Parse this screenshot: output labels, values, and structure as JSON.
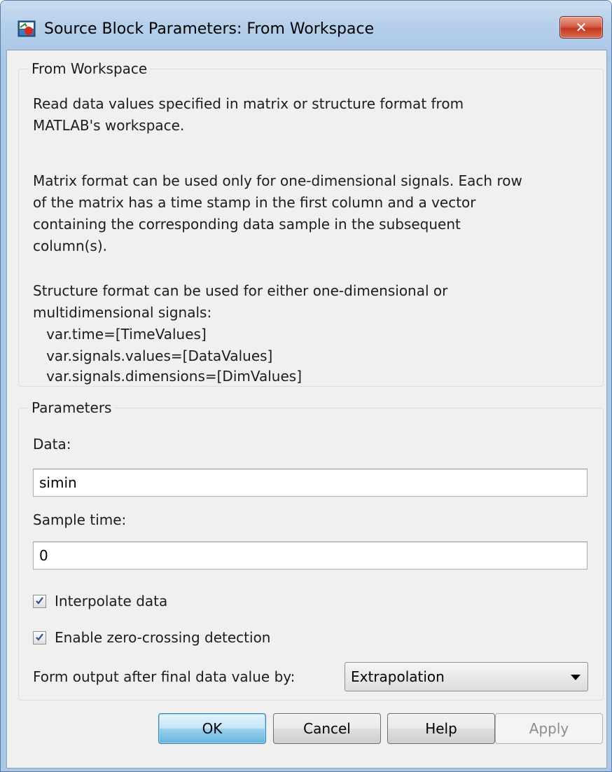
{
  "window": {
    "title": "Source Block Parameters: From Workspace",
    "close_glyph": "✕"
  },
  "description_group": {
    "label": "From Workspace",
    "lines": [
      "Read data values specified in matrix or structure format from",
      "MATLAB's workspace.",
      "",
      "Matrix format can be used only for one-dimensional signals. Each row",
      "of the matrix has a time stamp in the first column and a vector",
      "containing the corresponding data sample in the subsequent",
      "column(s).",
      "",
      "Structure format can be used for either one-dimensional or",
      "multidimensional signals:",
      "   var.time=[TimeValues]",
      "   var.signals.values=[DataValues]",
      "   var.signals.dimensions=[DimValues]"
    ]
  },
  "parameters_group": {
    "label": "Parameters",
    "data_label": "Data:",
    "data_value": "simin",
    "sample_time_label": "Sample time:",
    "sample_time_value": "0",
    "interpolate_label": "Interpolate data",
    "interpolate_checked": true,
    "zero_crossing_label": "Enable zero-crossing detection",
    "zero_crossing_checked": true,
    "form_output_label": "Form output after final data value by:",
    "form_output_value": "Extrapolation"
  },
  "buttons": {
    "ok": "OK",
    "cancel": "Cancel",
    "help": "Help",
    "apply": "Apply"
  },
  "colors": {
    "default_button": "#98d1ef",
    "close_button": "#c2381f",
    "checkmark": "#2a4d8f"
  }
}
